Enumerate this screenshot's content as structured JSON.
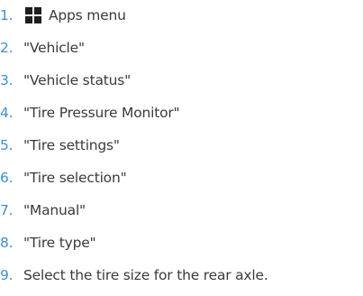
{
  "steps": [
    {
      "number": "1.",
      "icon": "apps-grid-icon",
      "text": "Apps menu"
    },
    {
      "number": "2.",
      "text": "\"Vehicle\""
    },
    {
      "number": "3.",
      "text": "\"Vehicle status\""
    },
    {
      "number": "4.",
      "text": "\"Tire Pressure Monitor\""
    },
    {
      "number": "5.",
      "text": "\"Tire settings\""
    },
    {
      "number": "6.",
      "text": "\"Tire selection\""
    },
    {
      "number": "7.",
      "text": "\"Manual\""
    },
    {
      "number": "8.",
      "text": "\"Tire type\""
    },
    {
      "number": "9.",
      "text": "Select the tire size for the rear axle."
    }
  ],
  "colors": {
    "number": "#3f8fd0",
    "text": "#3a3a3a",
    "icon": "#1e1e1e"
  }
}
